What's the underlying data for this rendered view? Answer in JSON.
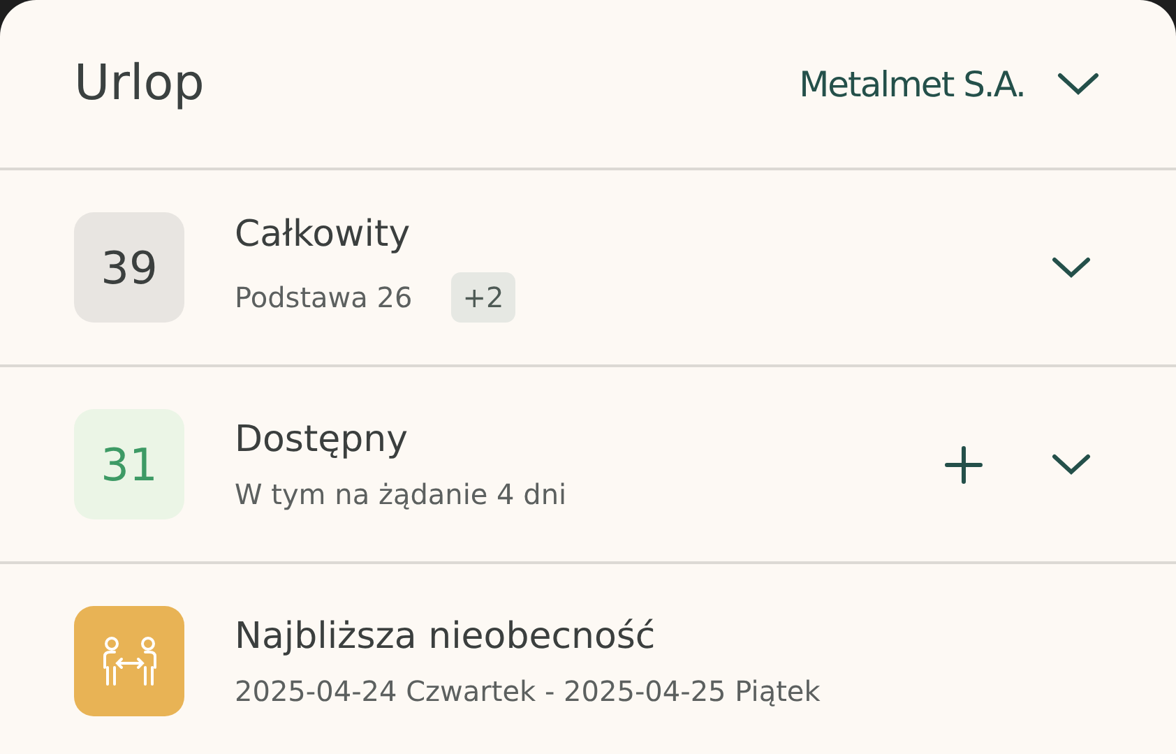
{
  "header": {
    "title": "Urlop",
    "company": "Metalmet S.A."
  },
  "rows": [
    {
      "kind": "total",
      "value": "39",
      "title": "Całkowity",
      "subtitle": "Podstawa 26",
      "badge": "+2",
      "addable": false,
      "expandable": true
    },
    {
      "kind": "available",
      "value": "31",
      "title": "Dostępny",
      "subtitle": "W tym na żądanie 4 dni",
      "addable": true,
      "expandable": true
    },
    {
      "kind": "absence",
      "title": "Najbliższa nieobecność",
      "subtitle": "2025-04-24 Czwartek - 2025-04-25 Piątek",
      "addable": false,
      "expandable": false
    }
  ]
}
